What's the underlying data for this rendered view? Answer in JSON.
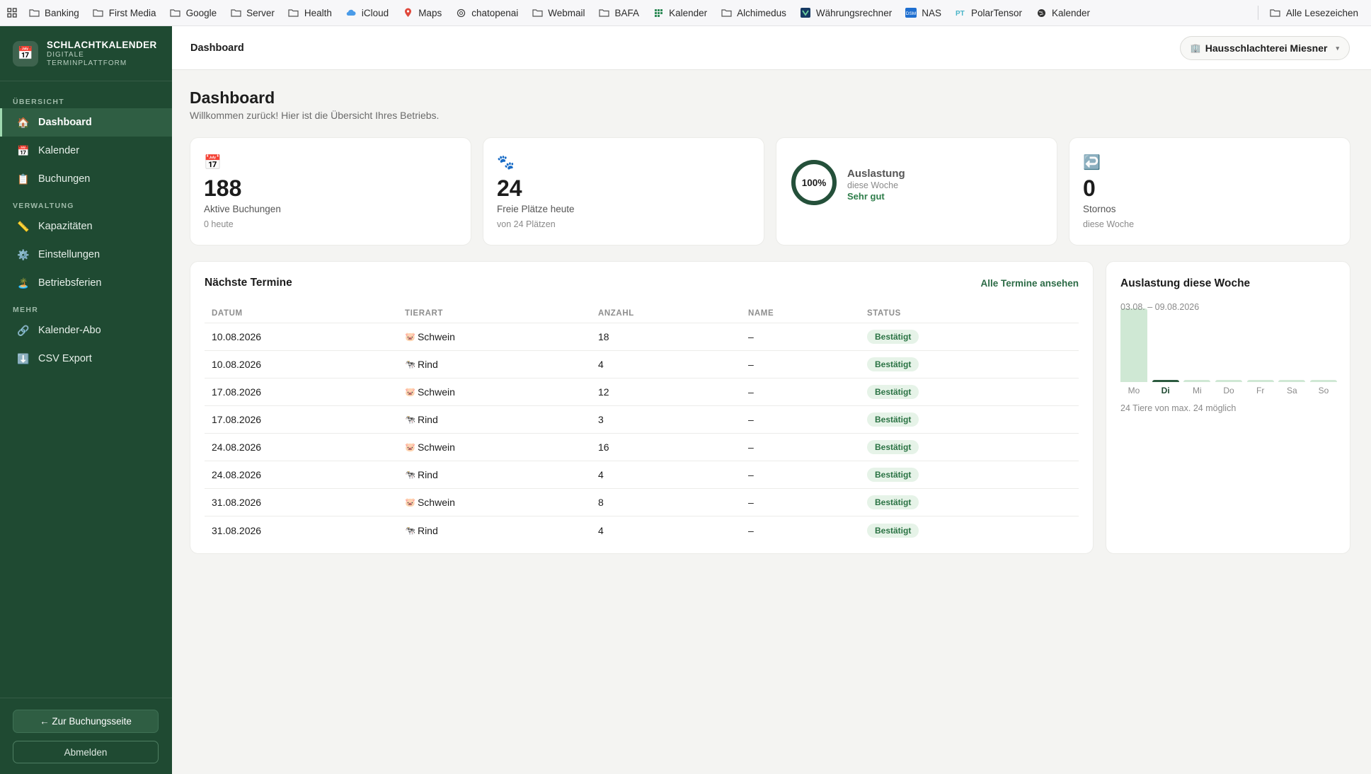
{
  "bookmarks": [
    {
      "label": "Banking",
      "icon": "folder-icon"
    },
    {
      "label": "First Media",
      "icon": "folder-icon"
    },
    {
      "label": "Google",
      "icon": "folder-icon"
    },
    {
      "label": "Server",
      "icon": "folder-icon"
    },
    {
      "label": "Health",
      "icon": "folder-icon"
    },
    {
      "label": "iCloud",
      "icon": "cloud-icon"
    },
    {
      "label": "Maps",
      "icon": "map-pin-icon"
    },
    {
      "label": "chatopenai",
      "icon": "openai-icon"
    },
    {
      "label": "Webmail",
      "icon": "folder-icon"
    },
    {
      "label": "BAFA",
      "icon": "folder-icon"
    },
    {
      "label": "Kalender",
      "icon": "calendar-grid-icon"
    },
    {
      "label": "Alchimedus",
      "icon": "folder-icon"
    },
    {
      "label": "Währungsrechner",
      "icon": "currency-icon"
    },
    {
      "label": "NAS",
      "icon": "nas-icon"
    },
    {
      "label": "PolarTensor",
      "icon": "polartensor-icon"
    },
    {
      "label": "Kalender",
      "icon": "globe-icon"
    }
  ],
  "bookmarks_all": "Alle Lesezeichen",
  "brand": {
    "title": "SCHLACHTKALENDER",
    "subtitle": "DIGITALE TERMINPLATTFORM",
    "icon": "📅"
  },
  "nav": {
    "section_overview": "ÜBERSICHT",
    "section_admin": "VERWALTUNG",
    "section_more": "MEHR",
    "dashboard": {
      "label": "Dashboard",
      "icon": "🏠"
    },
    "calendar": {
      "label": "Kalender",
      "icon": "📅"
    },
    "bookings": {
      "label": "Buchungen",
      "icon": "📋"
    },
    "capacities": {
      "label": "Kapazitäten",
      "icon": "📏"
    },
    "settings": {
      "label": "Einstellungen",
      "icon": "⚙️"
    },
    "holidays": {
      "label": "Betriebsferien",
      "icon": "🏝️"
    },
    "calendar_sub": {
      "label": "Kalender-Abo",
      "icon": "🔗"
    },
    "csv": {
      "label": "CSV Export",
      "icon": "⬇️"
    }
  },
  "sidebar_bottom": {
    "booking_page": "← Zur Buchungsseite",
    "logout": "Abmelden"
  },
  "header": {
    "title": "Dashboard",
    "org_icon": "🏢",
    "org_name": "Hausschlachterei Miesner",
    "org_chevron": "▾"
  },
  "page": {
    "title": "Dashboard",
    "subtitle": "Willkommen zurück! Hier ist die Übersicht Ihres Betriebs."
  },
  "stats": {
    "bookings": {
      "icon": "📅",
      "value": "188",
      "label": "Aktive Buchungen",
      "sub": "0 heute"
    },
    "free": {
      "icon": "🐾",
      "value": "24",
      "label": "Freie Plätze heute",
      "sub": "von 24 Plätzen"
    },
    "utilization": {
      "percent": "100%",
      "fraction": 1.0,
      "title": "Auslastung",
      "sub": "diese Woche",
      "rating": "Sehr gut"
    },
    "cancellations": {
      "icon": "↩️",
      "value": "0",
      "label": "Stornos",
      "sub": "diese Woche"
    }
  },
  "appointments": {
    "title": "Nächste Termine",
    "link": "Alle Termine ansehen",
    "columns": [
      "DATUM",
      "TIERART",
      "ANZAHL",
      "NAME",
      "STATUS"
    ],
    "rows": [
      {
        "date": "10.08.2026",
        "icon": "🐷",
        "animal": "Schwein",
        "count": "18",
        "name": "–",
        "status": "Bestätigt"
      },
      {
        "date": "10.08.2026",
        "icon": "🐄",
        "animal": "Rind",
        "count": "4",
        "name": "–",
        "status": "Bestätigt"
      },
      {
        "date": "17.08.2026",
        "icon": "🐷",
        "animal": "Schwein",
        "count": "12",
        "name": "–",
        "status": "Bestätigt"
      },
      {
        "date": "17.08.2026",
        "icon": "🐄",
        "animal": "Rind",
        "count": "3",
        "name": "–",
        "status": "Bestätigt"
      },
      {
        "date": "24.08.2026",
        "icon": "🐷",
        "animal": "Schwein",
        "count": "16",
        "name": "–",
        "status": "Bestätigt"
      },
      {
        "date": "24.08.2026",
        "icon": "🐄",
        "animal": "Rind",
        "count": "4",
        "name": "–",
        "status": "Bestätigt"
      },
      {
        "date": "31.08.2026",
        "icon": "🐷",
        "animal": "Schwein",
        "count": "8",
        "name": "–",
        "status": "Bestätigt"
      },
      {
        "date": "31.08.2026",
        "icon": "🐄",
        "animal": "Rind",
        "count": "4",
        "name": "–",
        "status": "Bestätigt"
      }
    ]
  },
  "chart_data": {
    "type": "bar",
    "title": "Auslastung diese Woche",
    "subtitle": "03.08. – 09.08.2026",
    "categories": [
      "Mo",
      "Di",
      "Mi",
      "Do",
      "Fr",
      "Sa",
      "So"
    ],
    "values": [
      1.0,
      0.03,
      0.03,
      0.03,
      0.03,
      0.03,
      0.03
    ],
    "highlight": "Di",
    "ylim": [
      0,
      1
    ],
    "footer": "24 Tiere von max. 24 möglich",
    "colors": {
      "bar": "#cfe8d4",
      "today": "#2b5a3e"
    }
  }
}
